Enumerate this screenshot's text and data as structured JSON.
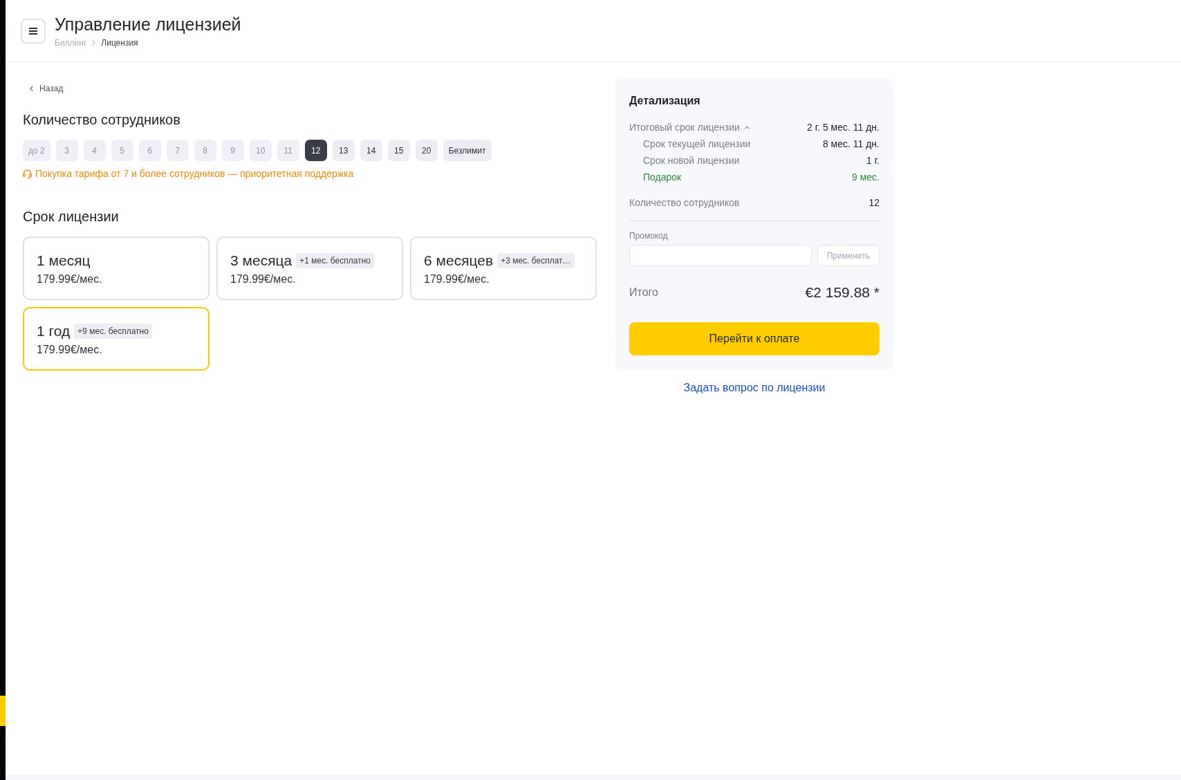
{
  "header": {
    "title": "Управление лицензией",
    "breadcrumbs": [
      {
        "label": "Биллинг",
        "current": false
      },
      {
        "label": "Лицензия",
        "current": true
      }
    ]
  },
  "back_link": "Назад",
  "employees": {
    "title": "Количество сотрудников",
    "options": [
      {
        "label": "до 2",
        "disabled": true,
        "selected": false
      },
      {
        "label": "3",
        "disabled": true,
        "selected": false
      },
      {
        "label": "4",
        "disabled": true,
        "selected": false
      },
      {
        "label": "5",
        "disabled": true,
        "selected": false
      },
      {
        "label": "6",
        "disabled": true,
        "selected": false
      },
      {
        "label": "7",
        "disabled": true,
        "selected": false
      },
      {
        "label": "8",
        "disabled": true,
        "selected": false
      },
      {
        "label": "9",
        "disabled": true,
        "selected": false
      },
      {
        "label": "10",
        "disabled": true,
        "selected": false
      },
      {
        "label": "11",
        "disabled": true,
        "selected": false
      },
      {
        "label": "12",
        "disabled": false,
        "selected": true
      },
      {
        "label": "13",
        "disabled": false,
        "selected": false
      },
      {
        "label": "14",
        "disabled": false,
        "selected": false
      },
      {
        "label": "15",
        "disabled": false,
        "selected": false
      },
      {
        "label": "20",
        "disabled": false,
        "selected": false
      },
      {
        "label": "Безлимит",
        "disabled": false,
        "selected": false
      }
    ],
    "note": "Покупка тарифа от 7 и более сотрудников — приоритетная поддержка"
  },
  "license_term": {
    "title": "Срок лицензии",
    "options": [
      {
        "title": "1 месяц",
        "price": "179.99€/мес.",
        "selected": false
      },
      {
        "title": "3 месяца",
        "badge": "+1 мес. бесплатно",
        "price": "179.99€/мес.",
        "selected": false
      },
      {
        "title": "6 месяцев",
        "badge": "+3 мес. бесплат…",
        "price": "179.99€/мес.",
        "selected": false
      },
      {
        "title": "1 год",
        "badge": "+9 мес. бесплатно",
        "price": "179.99€/мес.",
        "selected": true
      }
    ]
  },
  "details": {
    "title": "Детализация",
    "rows": [
      {
        "label": "Итоговый срок лицензии",
        "value": "2 г. 5 мес. 11 дн.",
        "expanded": true,
        "children": [
          {
            "label": "Срок текущей лицензии",
            "value": "8 мес. 11 дн.",
            "kind": "plain"
          },
          {
            "label": "Срок новой лицензии",
            "value": "1 г.",
            "kind": "plain"
          },
          {
            "label": "Подарок",
            "value": "9 мес.",
            "kind": "gift"
          }
        ]
      },
      {
        "label": "Количество сотрудников",
        "value": "12"
      }
    ],
    "promo": {
      "label": "Промокод",
      "apply_button": {
        "label": "Применить",
        "disabled": true
      }
    },
    "total": {
      "label": "Итого",
      "value": "€2 159.88 *"
    },
    "pay_button": "Перейти к оплате"
  },
  "help_link": "Задать вопрос по лицензии"
}
